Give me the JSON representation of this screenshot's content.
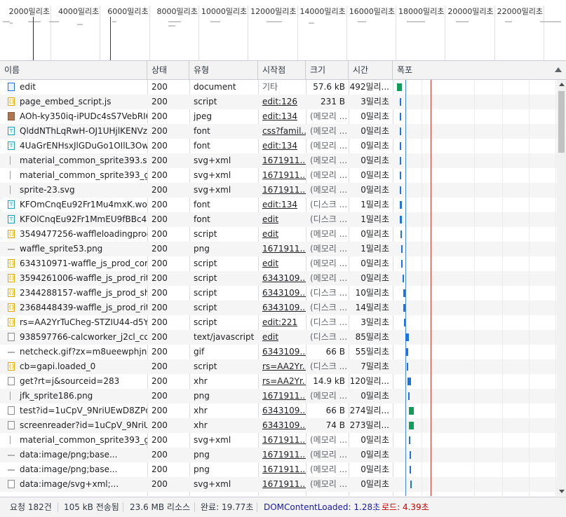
{
  "overview": {
    "ticks": [
      "2000밀리초",
      "4000밀리초",
      "6000밀리초",
      "8000밀리초",
      "10000밀리초",
      "12000밀리초",
      "14000밀리초",
      "16000밀리초",
      "18000밀리초",
      "20000밀리초",
      "22000밀리초",
      "2400"
    ]
  },
  "columns": {
    "name": "이름",
    "status": "상태",
    "type": "유형",
    "initiator": "시작점",
    "size": "크기",
    "time": "시간",
    "waterfall": "폭포"
  },
  "rows": [
    {
      "icon": "doc",
      "name": "edit",
      "status": "200",
      "type": "document",
      "initiator": "기타",
      "initiator_link": false,
      "size": "57.6 kB",
      "time": "492밀리..."
    },
    {
      "icon": "script",
      "name": "page_embed_script.js",
      "status": "200",
      "type": "script",
      "initiator": "edit:126",
      "initiator_link": true,
      "size": "231 B",
      "time": "3밀리초"
    },
    {
      "icon": "img",
      "name": "AOh-ky350iq-iPUDc4sS7VebRI6...",
      "status": "200",
      "type": "jpeg",
      "initiator": "edit:134",
      "initiator_link": true,
      "size": "(메모리 ...",
      "time": "0밀리초"
    },
    {
      "icon": "font",
      "name": "QlddNThLqRwH-OJ1UHjlKENVz...",
      "status": "200",
      "type": "font",
      "initiator": "css?famil...",
      "initiator_link": true,
      "size": "(메모리 ...",
      "time": "0밀리초"
    },
    {
      "icon": "font",
      "name": "4UaGrENHsxJlGDuGo1OIlL3Ow...",
      "status": "200",
      "type": "font",
      "initiator": "edit:134",
      "initiator_link": true,
      "size": "(메모리 ...",
      "time": "0밀리초"
    },
    {
      "icon": "svg",
      "name": "material_common_sprite393.svg",
      "status": "200",
      "type": "svg+xml",
      "initiator": "1671911...",
      "initiator_link": true,
      "size": "(메모리 ...",
      "time": "0밀리초"
    },
    {
      "icon": "svg",
      "name": "material_common_sprite393_gr...",
      "status": "200",
      "type": "svg+xml",
      "initiator": "1671911...",
      "initiator_link": true,
      "size": "(메모리 ...",
      "time": "0밀리초"
    },
    {
      "icon": "svg",
      "name": "sprite-23.svg",
      "status": "200",
      "type": "svg+xml",
      "initiator": "1671911...",
      "initiator_link": true,
      "size": "(메모리 ...",
      "time": "0밀리초"
    },
    {
      "icon": "font",
      "name": "KFOmCnqEu92Fr1Mu4mxK.woff2",
      "status": "200",
      "type": "font",
      "initiator": "edit:134",
      "initiator_link": true,
      "size": "(디스크 ...",
      "time": "1밀리초"
    },
    {
      "icon": "font",
      "name": "KFOlCnqEu92Fr1MmEU9fBBc4....",
      "status": "200",
      "type": "font",
      "initiator": "edit",
      "initiator_link": true,
      "size": "(디스크 ...",
      "time": "1밀리초"
    },
    {
      "icon": "script",
      "name": "3549477256-waffleloadingprog...",
      "status": "200",
      "type": "script",
      "initiator": "edit",
      "initiator_link": true,
      "size": "(메모리 ...",
      "time": "0밀리초"
    },
    {
      "icon": "png",
      "name": "waffle_sprite53.png",
      "status": "200",
      "type": "png",
      "initiator": "1671911...",
      "initiator_link": true,
      "size": "(메모리 ...",
      "time": "1밀리초"
    },
    {
      "icon": "script",
      "name": "634310971-waffle_js_prod_core...",
      "status": "200",
      "type": "script",
      "initiator": "edit",
      "initiator_link": true,
      "size": "(메모리 ...",
      "time": "0밀리초"
    },
    {
      "icon": "script",
      "name": "3594261006-waffle_js_prod_ritz...",
      "status": "200",
      "type": "script",
      "initiator": "6343109...",
      "initiator_link": true,
      "size": "(메모리 ...",
      "time": "0밀리초"
    },
    {
      "icon": "script",
      "name": "2344288157-waffle_js_prod_sh...",
      "status": "200",
      "type": "script",
      "initiator": "6343109...",
      "initiator_link": true,
      "size": "(디스크 ...",
      "time": "10밀리초"
    },
    {
      "icon": "script",
      "name": "2368448439-waffle_js_prod_ritz...",
      "status": "200",
      "type": "script",
      "initiator": "6343109...",
      "initiator_link": true,
      "size": "(디스크 ...",
      "time": "14밀리초"
    },
    {
      "icon": "script",
      "name": "rs=AA2YrTuCheg-STZIU44-d5Y...",
      "status": "200",
      "type": "script",
      "initiator": "edit:221",
      "initiator_link": true,
      "size": "(디스크 ...",
      "time": "3밀리초"
    },
    {
      "icon": "blank",
      "name": "938597766-calcworker_j2cl_cor...",
      "status": "200",
      "type": "text/javascript",
      "initiator": "edit",
      "initiator_link": true,
      "size": "(디스크 ...",
      "time": "85밀리초"
    },
    {
      "icon": "png",
      "name": "netcheck.gif?zx=m8ueewphjnml",
      "status": "200",
      "type": "gif",
      "initiator": "6343109...",
      "initiator_link": true,
      "size": "66 B",
      "time": "55밀리초"
    },
    {
      "icon": "script",
      "name": "cb=gapi.loaded_0",
      "status": "200",
      "type": "script",
      "initiator": "rs=AA2Yr...",
      "initiator_link": true,
      "size": "(디스크 ...",
      "time": "7밀리초"
    },
    {
      "icon": "blank",
      "name": "get?rt=j&sourceid=283",
      "status": "200",
      "type": "xhr",
      "initiator": "rs=AA2Yr...",
      "initiator_link": true,
      "size": "14.9 kB",
      "time": "120밀리..."
    },
    {
      "icon": "svg",
      "name": "jfk_sprite186.png",
      "status": "200",
      "type": "png",
      "initiator": "1671911...",
      "initiator_link": true,
      "size": "(메모리 ...",
      "time": "0밀리초"
    },
    {
      "icon": "blank",
      "name": "test?id=1uCpV_9NriUEwD8ZPq...",
      "status": "200",
      "type": "xhr",
      "initiator": "6343109...",
      "initiator_link": true,
      "size": "66 B",
      "time": "274밀리..."
    },
    {
      "icon": "blank",
      "name": "screenreader?id=1uCpV_9NriU...",
      "status": "200",
      "type": "xhr",
      "initiator": "6343109...",
      "initiator_link": true,
      "size": "74 B",
      "time": "273밀리..."
    },
    {
      "icon": "svg",
      "name": "material_common_sprite393_gr...",
      "status": "200",
      "type": "svg+xml",
      "initiator": "1671911...",
      "initiator_link": true,
      "size": "(메모리 ...",
      "time": "0밀리초"
    },
    {
      "icon": "png",
      "name": "data:image/png;base...",
      "status": "200",
      "type": "png",
      "initiator": "1671911...",
      "initiator_link": true,
      "size": "(메모리 ...",
      "time": "0밀리초"
    },
    {
      "icon": "png",
      "name": "data:image/png;base...",
      "status": "200",
      "type": "png",
      "initiator": "1671911...",
      "initiator_link": true,
      "size": "(메모리 ...",
      "time": "0밀리초"
    },
    {
      "icon": "blank",
      "name": "data:image/svg+xml;...",
      "status": "200",
      "type": "svg+xml",
      "initiator": "1671911...",
      "initiator_link": true,
      "size": "(메모리 ...",
      "time": "0밀리초"
    }
  ],
  "status_bar": {
    "requests": "요청 182건",
    "transferred": "105 kB 전송됨",
    "resources": "23.6 MB 리소스",
    "finish": "완료: 19.77초",
    "dcl": "DOMContentLoaded: 1.28초",
    "load": "로드: 4.39초"
  },
  "colors": {
    "dcl": "#1a1aa6",
    "load": "#c80000",
    "blue_line": "#4285f4",
    "red_line": "#d93025"
  }
}
